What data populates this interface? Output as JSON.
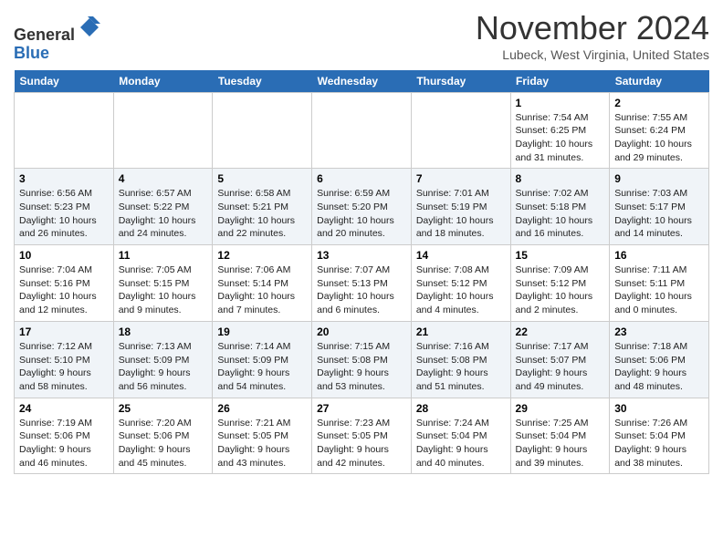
{
  "header": {
    "logo_line1": "General",
    "logo_line2": "Blue",
    "month_title": "November 2024",
    "location": "Lubeck, West Virginia, United States"
  },
  "weekdays": [
    "Sunday",
    "Monday",
    "Tuesday",
    "Wednesday",
    "Thursday",
    "Friday",
    "Saturday"
  ],
  "weeks": [
    [
      {
        "day": "",
        "info": ""
      },
      {
        "day": "",
        "info": ""
      },
      {
        "day": "",
        "info": ""
      },
      {
        "day": "",
        "info": ""
      },
      {
        "day": "",
        "info": ""
      },
      {
        "day": "1",
        "info": "Sunrise: 7:54 AM\nSunset: 6:25 PM\nDaylight: 10 hours\nand 31 minutes."
      },
      {
        "day": "2",
        "info": "Sunrise: 7:55 AM\nSunset: 6:24 PM\nDaylight: 10 hours\nand 29 minutes."
      }
    ],
    [
      {
        "day": "3",
        "info": "Sunrise: 6:56 AM\nSunset: 5:23 PM\nDaylight: 10 hours\nand 26 minutes."
      },
      {
        "day": "4",
        "info": "Sunrise: 6:57 AM\nSunset: 5:22 PM\nDaylight: 10 hours\nand 24 minutes."
      },
      {
        "day": "5",
        "info": "Sunrise: 6:58 AM\nSunset: 5:21 PM\nDaylight: 10 hours\nand 22 minutes."
      },
      {
        "day": "6",
        "info": "Sunrise: 6:59 AM\nSunset: 5:20 PM\nDaylight: 10 hours\nand 20 minutes."
      },
      {
        "day": "7",
        "info": "Sunrise: 7:01 AM\nSunset: 5:19 PM\nDaylight: 10 hours\nand 18 minutes."
      },
      {
        "day": "8",
        "info": "Sunrise: 7:02 AM\nSunset: 5:18 PM\nDaylight: 10 hours\nand 16 minutes."
      },
      {
        "day": "9",
        "info": "Sunrise: 7:03 AM\nSunset: 5:17 PM\nDaylight: 10 hours\nand 14 minutes."
      }
    ],
    [
      {
        "day": "10",
        "info": "Sunrise: 7:04 AM\nSunset: 5:16 PM\nDaylight: 10 hours\nand 12 minutes."
      },
      {
        "day": "11",
        "info": "Sunrise: 7:05 AM\nSunset: 5:15 PM\nDaylight: 10 hours\nand 9 minutes."
      },
      {
        "day": "12",
        "info": "Sunrise: 7:06 AM\nSunset: 5:14 PM\nDaylight: 10 hours\nand 7 minutes."
      },
      {
        "day": "13",
        "info": "Sunrise: 7:07 AM\nSunset: 5:13 PM\nDaylight: 10 hours\nand 6 minutes."
      },
      {
        "day": "14",
        "info": "Sunrise: 7:08 AM\nSunset: 5:12 PM\nDaylight: 10 hours\nand 4 minutes."
      },
      {
        "day": "15",
        "info": "Sunrise: 7:09 AM\nSunset: 5:12 PM\nDaylight: 10 hours\nand 2 minutes."
      },
      {
        "day": "16",
        "info": "Sunrise: 7:11 AM\nSunset: 5:11 PM\nDaylight: 10 hours\nand 0 minutes."
      }
    ],
    [
      {
        "day": "17",
        "info": "Sunrise: 7:12 AM\nSunset: 5:10 PM\nDaylight: 9 hours\nand 58 minutes."
      },
      {
        "day": "18",
        "info": "Sunrise: 7:13 AM\nSunset: 5:09 PM\nDaylight: 9 hours\nand 56 minutes."
      },
      {
        "day": "19",
        "info": "Sunrise: 7:14 AM\nSunset: 5:09 PM\nDaylight: 9 hours\nand 54 minutes."
      },
      {
        "day": "20",
        "info": "Sunrise: 7:15 AM\nSunset: 5:08 PM\nDaylight: 9 hours\nand 53 minutes."
      },
      {
        "day": "21",
        "info": "Sunrise: 7:16 AM\nSunset: 5:08 PM\nDaylight: 9 hours\nand 51 minutes."
      },
      {
        "day": "22",
        "info": "Sunrise: 7:17 AM\nSunset: 5:07 PM\nDaylight: 9 hours\nand 49 minutes."
      },
      {
        "day": "23",
        "info": "Sunrise: 7:18 AM\nSunset: 5:06 PM\nDaylight: 9 hours\nand 48 minutes."
      }
    ],
    [
      {
        "day": "24",
        "info": "Sunrise: 7:19 AM\nSunset: 5:06 PM\nDaylight: 9 hours\nand 46 minutes."
      },
      {
        "day": "25",
        "info": "Sunrise: 7:20 AM\nSunset: 5:06 PM\nDaylight: 9 hours\nand 45 minutes."
      },
      {
        "day": "26",
        "info": "Sunrise: 7:21 AM\nSunset: 5:05 PM\nDaylight: 9 hours\nand 43 minutes."
      },
      {
        "day": "27",
        "info": "Sunrise: 7:23 AM\nSunset: 5:05 PM\nDaylight: 9 hours\nand 42 minutes."
      },
      {
        "day": "28",
        "info": "Sunrise: 7:24 AM\nSunset: 5:04 PM\nDaylight: 9 hours\nand 40 minutes."
      },
      {
        "day": "29",
        "info": "Sunrise: 7:25 AM\nSunset: 5:04 PM\nDaylight: 9 hours\nand 39 minutes."
      },
      {
        "day": "30",
        "info": "Sunrise: 7:26 AM\nSunset: 5:04 PM\nDaylight: 9 hours\nand 38 minutes."
      }
    ]
  ]
}
